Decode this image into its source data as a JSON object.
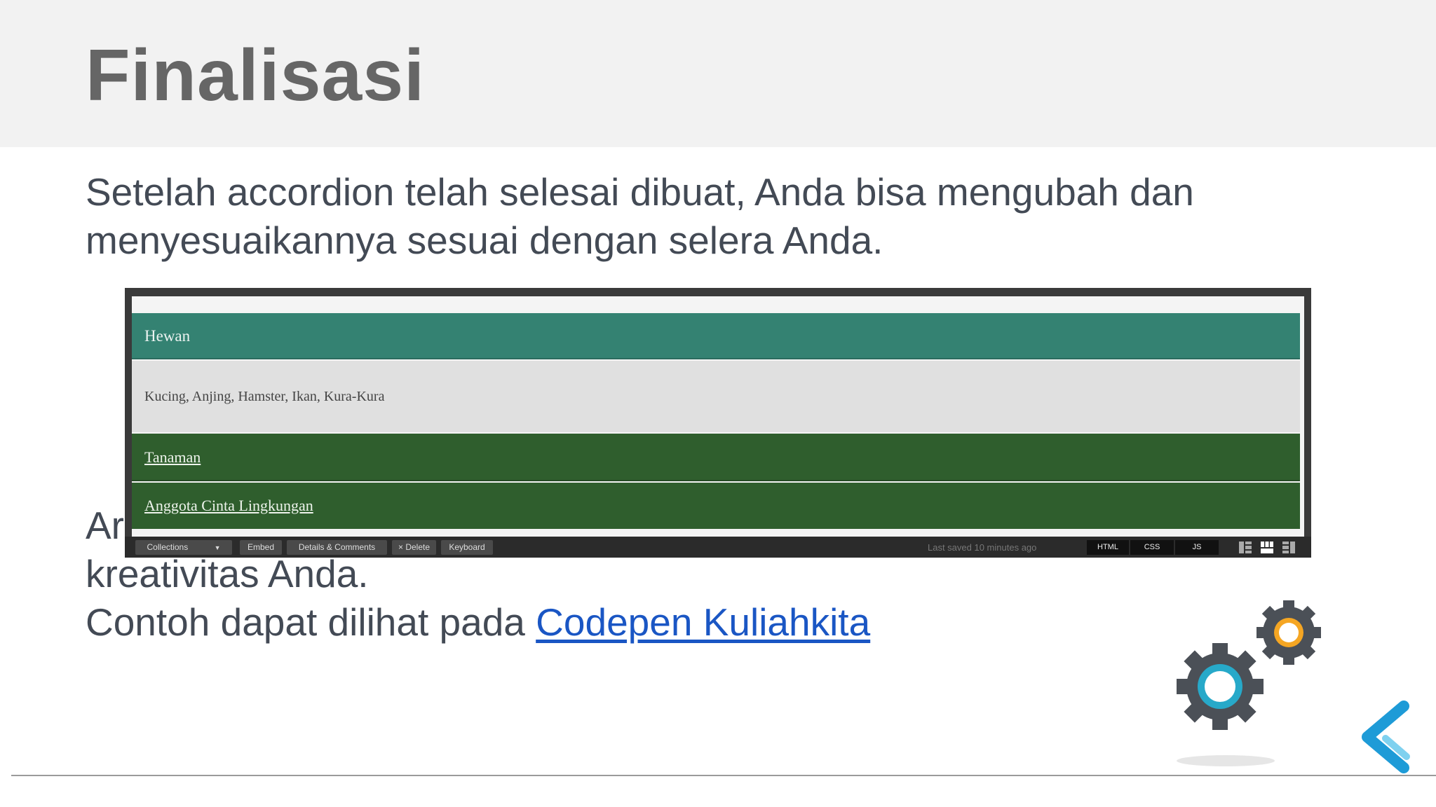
{
  "slide": {
    "title": "Finalisasi",
    "paragraph_1": "Setelah accordion telah selesai dibuat, Anda bisa mengubah dan menyesuaikannya sesuai dengan selera Anda.",
    "paragraph_2_partial": "Ar",
    "paragraph_2_end": "kreativitas Anda.",
    "paragraph_3_prefix": "Contoh dapat dilihat pada ",
    "paragraph_3_link": "Codepen Kuliahkita"
  },
  "accordion": {
    "items": [
      {
        "label": "Hewan",
        "content": "Kucing, Anjing, Hamster, Ikan, Kura-Kura"
      },
      {
        "label": "Tanaman"
      },
      {
        "label": "Anggota Cinta Lingkungan"
      }
    ]
  },
  "codepen_bar": {
    "collections": "Collections",
    "embed": "Embed",
    "details": "Details & Comments",
    "delete": "× Delete",
    "keyboard": "Keyboard",
    "saved": "Last saved 10 minutes ago",
    "html": "HTML",
    "css": "CSS",
    "js": "JS"
  },
  "colors": {
    "hewan_header": "#348272",
    "green_header": "#2f5e2d",
    "link": "#1a56c4",
    "gear_dark": "#4b5057",
    "gear_ring_blue": "#27a9c9",
    "gear_ring_orange": "#f5a623",
    "logo": "#1e9bd7"
  },
  "icons": [
    "gear-large-icon",
    "gear-small-icon",
    "kuliahkita-logo-icon",
    "layout-icon"
  ]
}
